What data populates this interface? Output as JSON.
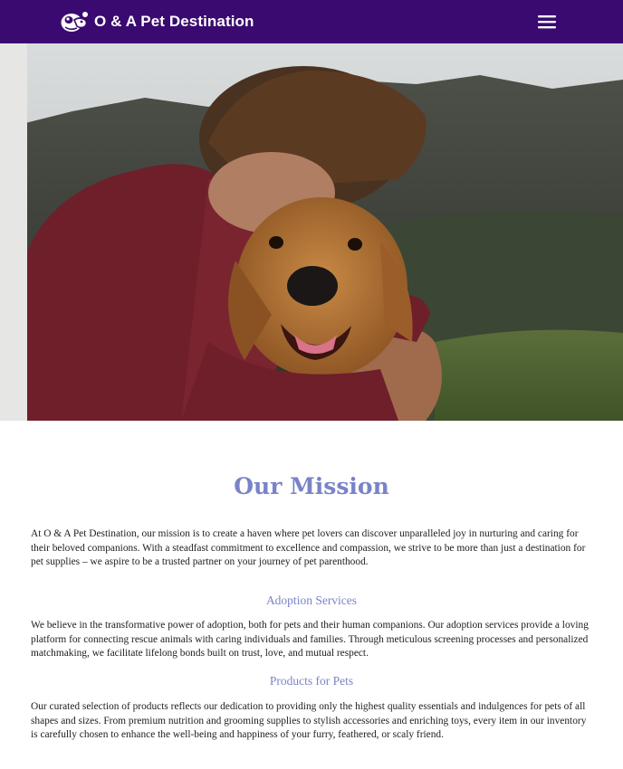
{
  "navbar": {
    "brand_name": "O & A Pet Destination",
    "logo_icon": "pet-paw-logo-icon",
    "menu_icon": "hamburger-menu-icon",
    "background_color": "#3a0a70"
  },
  "hero": {
    "image_description_icon": "man-hugging-dog-photo"
  },
  "mission": {
    "title": "Our Mission",
    "intro": "At O & A Pet Destination, our mission is to create a haven where pet lovers can discover unparalleled joy in nurturing and caring for their beloved companions. With a steadfast commitment to excellence and compassion, we strive to be more than just a destination for pet supplies – we aspire to be a trusted partner on your journey of pet parenthood."
  },
  "sections": [
    {
      "heading": "Adoption Services",
      "body": "We believe in the transformative power of adoption, both for pets and their human companions. Our adoption services provide a loving platform for connecting rescue animals with caring individuals and families. Through meticulous screening processes and personalized matchmaking, we facilitate lifelong bonds built on trust, love, and mutual respect."
    },
    {
      "heading": "Products for Pets",
      "body": "Our curated selection of products reflects our dedication to providing only the highest quality essentials and indulgences for pets of all shapes and sizes. From premium nutrition and grooming supplies to stylish accessories and enriching toys, every item in our inventory is carefully chosen to enhance the well-being and happiness of your furry, feathered, or scaly friend."
    }
  ],
  "colors": {
    "accent": "#7a83c7",
    "nav": "#3a0a70"
  }
}
